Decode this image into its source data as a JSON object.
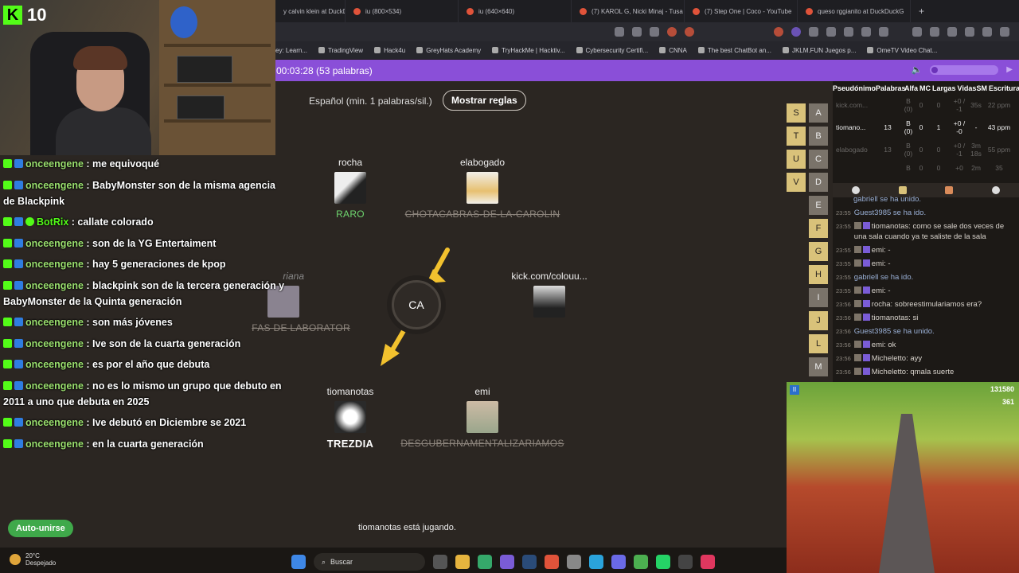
{
  "browser": {
    "tabs": [
      {
        "title": "y calvin klein at DuckDu"
      },
      {
        "title": "iu (800×534)"
      },
      {
        "title": "iu (640×640)"
      },
      {
        "title": "(7) KAROL G, Nicki Minaj - Tusa"
      },
      {
        "title": "(7) Step One | Coco - YouTube"
      },
      {
        "title": "queso rggianito at DuckDuckG"
      }
    ],
    "bookmarks": [
      "ey: Learn...",
      "TradingView",
      "Hack4u",
      "GreyHats Academy",
      "TryHackMe | Hacktiv...",
      "Cybersecurity Certifi...",
      "CNNA",
      "The best ChatBot an...",
      "JKLM.FUN Juegos p...",
      "OmeTV Video Chat..."
    ]
  },
  "status": {
    "timer_text": "00:03:28 (53 palabras)"
  },
  "game": {
    "lang": "Español (min. 1 palabras/sil.)",
    "rules_button": "Mostrar reglas",
    "center_syllable": "CA",
    "players": {
      "rocha": {
        "name": "rocha",
        "word": "RARO"
      },
      "elabogado": {
        "name": "elabogado",
        "word": "CHOTACABRAS-DE-LA-CAROLIN"
      },
      "ghost": {
        "name": "riana",
        "word": "FAS DE LABORATOR"
      },
      "kick": {
        "name": "kick.com/colouu..."
      },
      "tiomanotas": {
        "name": "tiomanotas",
        "word": "TREZDIA"
      },
      "emi": {
        "name": "emi",
        "word": "DESGUBERNAMENTALIZARIAMOS"
      }
    },
    "autojoin": "Auto-unirse",
    "playing_text": "tiomanotas está jugando."
  },
  "stream": {
    "viewer_count": "10"
  },
  "chat": [
    {
      "user": "onceengene",
      "text": ": me equivoqué"
    },
    {
      "user": "onceengene",
      "text": ": BabyMonster son de la misma agencia de Blackpink"
    },
    {
      "user": "BotRix",
      "text": ": callate colorado",
      "bot": true
    },
    {
      "user": "onceengene",
      "text": ": son de la YG Entertaiment"
    },
    {
      "user": "onceengene",
      "text": ": hay 5 generaciones de kpop"
    },
    {
      "user": "onceengene",
      "text": ": blackpink son de la tercera generación y BabyMonster de la Quinta generación"
    },
    {
      "user": "onceengene",
      "text": ": son más jóvenes"
    },
    {
      "user": "onceengene",
      "text": ": Ive son de la cuarta generación"
    },
    {
      "user": "onceengene",
      "text": ": es por el año que debuta"
    },
    {
      "user": "onceengene",
      "text": ": no es lo mismo un grupo que debuto en 2011 a uno que debuta en 2025"
    },
    {
      "user": "onceengene",
      "text": ": Ive debutó en Diciembre se 2021"
    },
    {
      "user": "onceengene",
      "text": ": en la cuarta generación"
    }
  ],
  "letters": [
    "S",
    "A",
    "T",
    "B",
    "U",
    "C",
    "V",
    "D",
    "E",
    "F",
    "G",
    "H",
    "I",
    "J",
    "L",
    "M"
  ],
  "scoreboard": {
    "headers": [
      "Pseudónimo",
      "Palabras",
      "Alfa",
      "MC",
      "Largas",
      "Vidas",
      "SM",
      "Escritura"
    ],
    "rows": [
      {
        "name": "kick.com...",
        "words": "",
        "alfa": "B (0)",
        "mc": "0",
        "largas": "0",
        "vidas": "+0 / -1",
        "sm": "35s",
        "esc": "22 ppm",
        "dim": true
      },
      {
        "name": "tiomano...",
        "words": "13",
        "alfa": "B (0)",
        "mc": "0",
        "largas": "1",
        "vidas": "+0 / -0",
        "sm": "-",
        "esc": "43 ppm",
        "dim": false
      },
      {
        "name": "elabogado",
        "words": "13",
        "alfa": "B (0)",
        "mc": "0",
        "largas": "0",
        "vidas": "+0 / -1",
        "sm": "3m 18s",
        "esc": "55 ppm",
        "dim": true
      },
      {
        "name": "",
        "words": "",
        "alfa": "B",
        "mc": "0",
        "largas": "0",
        "vidas": "+0",
        "sm": "2m",
        "esc": "35",
        "dim": true
      }
    ]
  },
  "log": [
    {
      "time": "",
      "text": "gabriell se ha unido.",
      "sys": true
    },
    {
      "time": "23:55",
      "text": "Guest3985 se ha ido.",
      "sys": true
    },
    {
      "time": "23:55",
      "text": "tiomanotas: como se sale dos veces de una sala cuando ya te saliste de la sala"
    },
    {
      "time": "23:55",
      "text": "emi: -"
    },
    {
      "time": "23:55",
      "text": "emi: -"
    },
    {
      "time": "23:55",
      "text": "gabriell se ha ido.",
      "sys": true
    },
    {
      "time": "23:55",
      "text": "emi: -"
    },
    {
      "time": "23:56",
      "text": "rocha: sobreestimulariamos era?"
    },
    {
      "time": "23:56",
      "text": "tiomanotas: si"
    },
    {
      "time": "23:56",
      "text": "Guest3985 se ha unido.",
      "sys": true
    },
    {
      "time": "23:56",
      "text": "emi: ok"
    },
    {
      "time": "23:56",
      "text": "Micheletto: ayy"
    },
    {
      "time": "23:56",
      "text": "Micheletto: qmala suerte"
    }
  ],
  "subway": {
    "score": "131580",
    "coins": "361"
  },
  "taskbar": {
    "temp": "20°C",
    "weather": "Despejado",
    "search": "Buscar"
  }
}
